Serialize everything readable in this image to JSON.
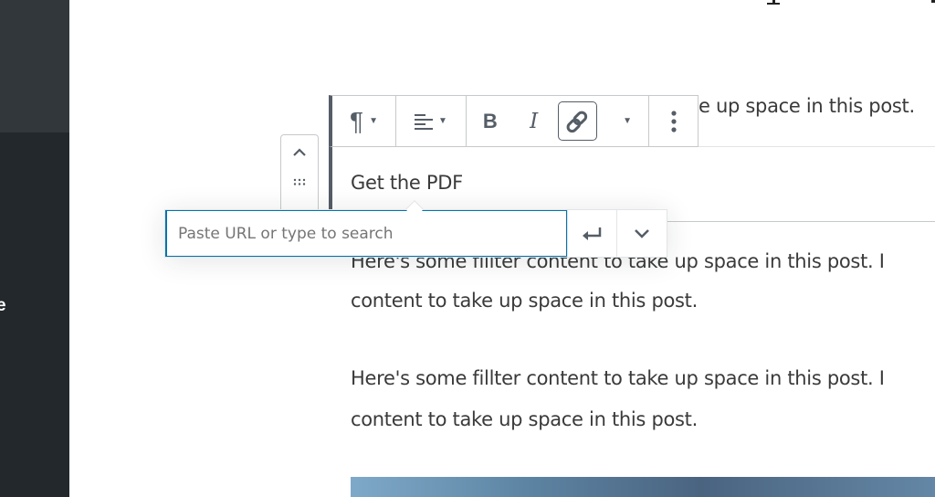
{
  "sidebar": {
    "partial_label": "e"
  },
  "toolbar": {
    "paragraph_icon": "¶",
    "align_icon": "align-left",
    "bold_label": "B",
    "italic_label": "I",
    "link_icon": "link",
    "more_icon": "more-vertical"
  },
  "block": {
    "heading_text": "Get the PDF",
    "behind_toolbar_text": "e up space in this post."
  },
  "link_popover": {
    "placeholder": "Paste URL or type to search",
    "submit_icon": "enter",
    "options_icon": "chevron-down"
  },
  "content": {
    "paragraphs": [
      {
        "line1": "Here's some fillter content to take up space in this post. I",
        "line2": "content to take up space in this post."
      },
      {
        "line1": "Here's some fillter content to take up space in this post. I",
        "line2": "content to take up space in this post."
      }
    ]
  },
  "colors": {
    "accent": "#0073aa",
    "sidebar": "#23282d",
    "sidebar_top": "#32373c",
    "text": "#3a3a3a"
  }
}
